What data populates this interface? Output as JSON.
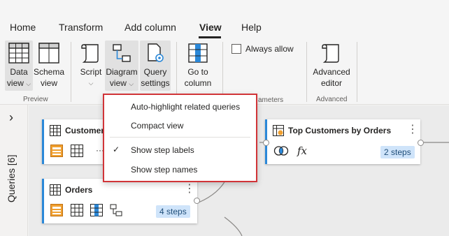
{
  "tabs": [
    "Home",
    "Transform",
    "Add column",
    "View",
    "Help"
  ],
  "ribbon": {
    "data_view": [
      "Data",
      "view"
    ],
    "schema_view": [
      "Schema",
      "view"
    ],
    "script": "Script",
    "diagram_view": [
      "Diagram",
      "view"
    ],
    "query_settings": [
      "Query",
      "settings"
    ],
    "go_to_column": [
      "Go to",
      "column"
    ],
    "always_allow": "Always allow",
    "advanced_editor": [
      "Advanced",
      "editor"
    ],
    "groups": {
      "preview": "Preview",
      "parameters": "ameters",
      "advanced": "Advanced"
    }
  },
  "leftpane": {
    "label": "Queries [6]",
    "expand_glyph": "›"
  },
  "menu": {
    "items": [
      "Auto-highlight related queries",
      "Compact view",
      "Show step labels",
      "Show step names"
    ],
    "checked_glyph": "✓"
  },
  "cards": {
    "customers": {
      "title": "Customers",
      "more": "···"
    },
    "orders": {
      "title": "Orders",
      "steps": "4 steps"
    },
    "top_customers": {
      "title": "Top Customers by Orders",
      "steps": "2 steps",
      "fx": "fx"
    }
  },
  "kebab_glyph": "⋮",
  "colors": {
    "accent": "#2b88d8",
    "menu_border": "#d13438",
    "steps_bg": "#cfe4fa"
  }
}
